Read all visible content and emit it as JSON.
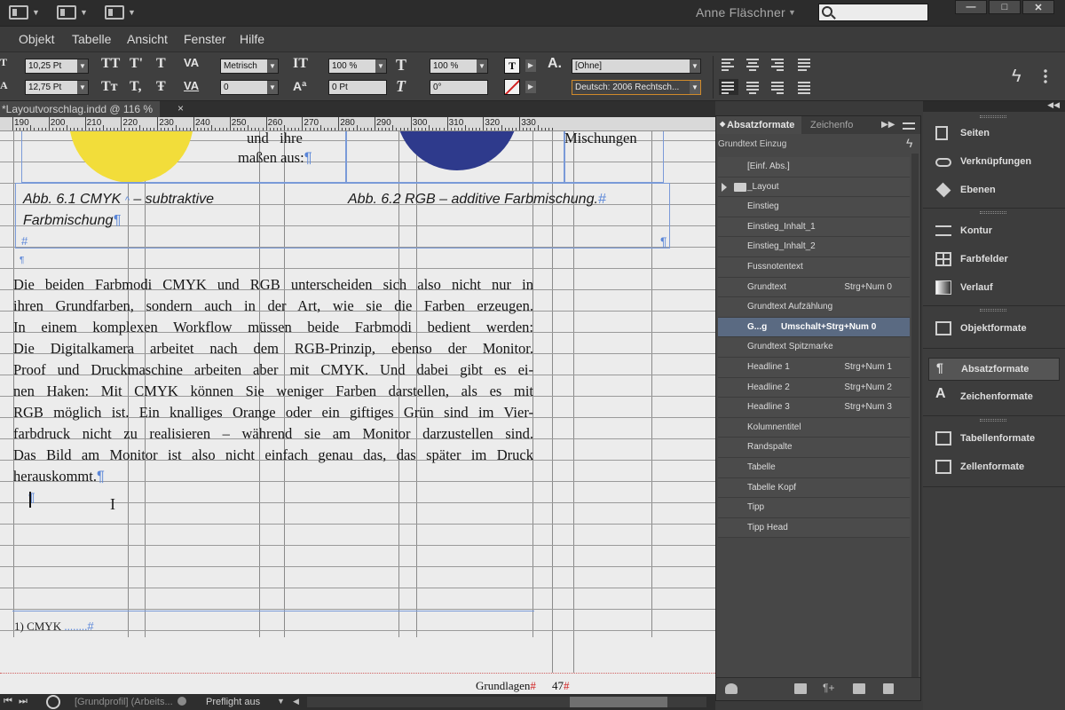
{
  "app": {
    "user_name": "Anne Fläschner",
    "search_placeholder": "",
    "window_minimize": "—",
    "window_maximize": "□",
    "window_close": "✕"
  },
  "menus": [
    "Objekt",
    "Tabelle",
    "Ansicht",
    "Fenster",
    "Hilfe"
  ],
  "control_panel": {
    "font_size": "10,25 Pt",
    "leading": "12,75 Pt",
    "kerning": "Metrisch",
    "tracking": "0",
    "vertical_scale": "100 %",
    "horizontal_scale": "100 %",
    "baseline_shift": "0 Pt",
    "skew": "0°",
    "char_style": "[Ohne]",
    "language": "Deutsch: 2006 Rechtsch...",
    "glyph_tt": "TT",
    "glyph_tsup": "T'",
    "glyph_tsmall": "T",
    "glyph_tt2": "Tт",
    "glyph_tsub": "T,",
    "glyph_tstrike": "Ŧ",
    "glyph_a": "A."
  },
  "document": {
    "tab_title": "*Layoutvorschlag.indd @ 116 %",
    "tab_close": "×",
    "ruler_labels": [
      "190",
      "200",
      "210",
      "220",
      "230",
      "240",
      "250",
      "260",
      "270",
      "280",
      "290",
      "300",
      "310",
      "320",
      "330"
    ],
    "text_top_left_1": "und",
    "text_top_left_2": "ihre",
    "text_top_left_3": "maßen aus:",
    "text_top_right": "Mischungen",
    "caption_1a": "Abb.    6.1      CMYK  ",
    "caption_1b": " –    subtraktive",
    "caption_1c": "Farbmischung",
    "caption_2": "Abb. 6.2  RGB – additive Farbmischung.",
    "body_lines": [
      "Die beiden Farbmodi CMYK und RGB unterscheiden sich also nicht nur in",
      "ihren Grundfarben, sondern auch in der Art, wie sie die Farben erzeugen.",
      "In einem komplexen Workflow müssen beide Farbmodi bedient werden:",
      "Die Digitalkamera arbeitet nach dem RGB-Prinzip, ebenso der Monitor.",
      "Proof und Druckmaschine arbeiten aber mit CMYK. Und dabei gibt es ei-",
      "nen Haken: Mit CMYK können Sie weniger Farben darstellen, als es mit",
      "RGB möglich ist. Ein knalliges Orange oder ein giftiges Grün sind im Vier-",
      "farbdruck nicht zu realisieren – während sie am Monitor darzustellen sind.",
      "Das Bild am Monitor ist also nicht einfach genau das, das später im Druck",
      "herauskommt."
    ],
    "footnote": "1) CMYK",
    "footer_label": "Grundlagen",
    "page_number": "47",
    "pilcrow": "¶",
    "hash": "#"
  },
  "status_bar": {
    "profile": "[Grundprofil] (Arbeits...",
    "preflight": "Preflight aus"
  },
  "paragraph_styles_panel": {
    "tab_active": "Absatzformate",
    "tab_2": "Zeichenfo",
    "current_style": "Grundtext Einzug",
    "styles": [
      {
        "label": "[Einf. Abs.]",
        "shortcut": ""
      },
      {
        "label": "_Layout",
        "shortcut": ""
      },
      {
        "label": "Einstieg",
        "shortcut": ""
      },
      {
        "label": "Einstieg_Inhalt_1",
        "shortcut": ""
      },
      {
        "label": "Einstieg_Inhalt_2",
        "shortcut": ""
      },
      {
        "label": "Fussnotentext",
        "shortcut": ""
      },
      {
        "label": "Grundtext",
        "shortcut": "Strg+Num 0"
      },
      {
        "label": "Grundtext Aufzählung",
        "shortcut": ""
      },
      {
        "label": "G...g",
        "shortcut": "Umschalt+Strg+Num 0"
      },
      {
        "label": "Grundtext Spitzmarke",
        "shortcut": ""
      },
      {
        "label": "Headline 1",
        "shortcut": "Strg+Num 1"
      },
      {
        "label": "Headline 2",
        "shortcut": "Strg+Num 2"
      },
      {
        "label": "Headline 3",
        "shortcut": "Strg+Num 3"
      },
      {
        "label": "Kolumnentitel",
        "shortcut": ""
      },
      {
        "label": "Randspalte",
        "shortcut": ""
      },
      {
        "label": "Tabelle",
        "shortcut": ""
      },
      {
        "label": "Tabelle Kopf",
        "shortcut": ""
      },
      {
        "label": "Tipp",
        "shortcut": ""
      },
      {
        "label": "Tipp Head",
        "shortcut": ""
      }
    ]
  },
  "dock": {
    "items": [
      "Seiten",
      "Verknüpfungen",
      "Ebenen",
      "Kontur",
      "Farbfelder",
      "Verlauf",
      "Objektformate",
      "Absatzformate",
      "Zeichenformate",
      "Tabellenformate",
      "Zellenformate"
    ]
  },
  "colors": {
    "yellow_circle": "#f2dd3a",
    "blue_circle": "#2e3a8c",
    "selection": "#5a6a82",
    "frame": "#7a9ad8"
  }
}
